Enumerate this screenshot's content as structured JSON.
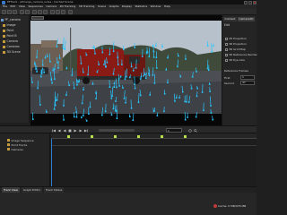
{
  "window": {
    "title": "PFTrack - pfmerge_camera_solve - Cached Scene"
  },
  "menu": [
    "File",
    "Edit",
    "View",
    "Sequences",
    "Camera",
    "2D Tracking",
    "3D Tracking",
    "Scene",
    "Graphs",
    "Display",
    "Statistics",
    "Window",
    "Help"
  ],
  "left_panel": {
    "items": [
      {
        "label": "PF_camera",
        "icon": "folder"
      },
      {
        "label": "Image",
        "icon": "folder"
      },
      {
        "label": "Point",
        "icon": "folder"
      },
      {
        "label": "Point B",
        "icon": "folder"
      },
      {
        "label": "Camera",
        "icon": "folder"
      },
      {
        "label": "Cameras",
        "icon": "folder"
      },
      {
        "label": "3D Scene",
        "icon": "folder"
      }
    ]
  },
  "right_panel": {
    "tabs": [
      "Context",
      "Camera2D"
    ],
    "header": "Edit",
    "options": [
      "2D Projection",
      "3D Projection",
      "3D Grid Map",
      "3D Reference Render",
      "3D Eye Axis"
    ],
    "fields": [
      {
        "label": "Reference Frames",
        "value": ""
      },
      {
        "label": "First",
        "value": "1"
      },
      {
        "label": "Second",
        "value": "47"
      }
    ]
  },
  "transport": {
    "frame": "1"
  },
  "bottom_panel": {
    "items": [
      "Image Sequence",
      "Point Tracks",
      "Cameras"
    ]
  },
  "bottom_tabs": [
    {
      "label": "Track View",
      "active": true
    },
    {
      "label": "Graph Editor",
      "active": false
    },
    {
      "label": "Track Status",
      "active": false
    }
  ],
  "status": {
    "text": "Cache: 0 MB/976 MB"
  },
  "colors": {
    "track_marker": "#29c6ff",
    "keyframe": "#b8e04a",
    "truck": "#8a1a14",
    "sky": "#b5bfca",
    "road": "#4a4d52"
  }
}
